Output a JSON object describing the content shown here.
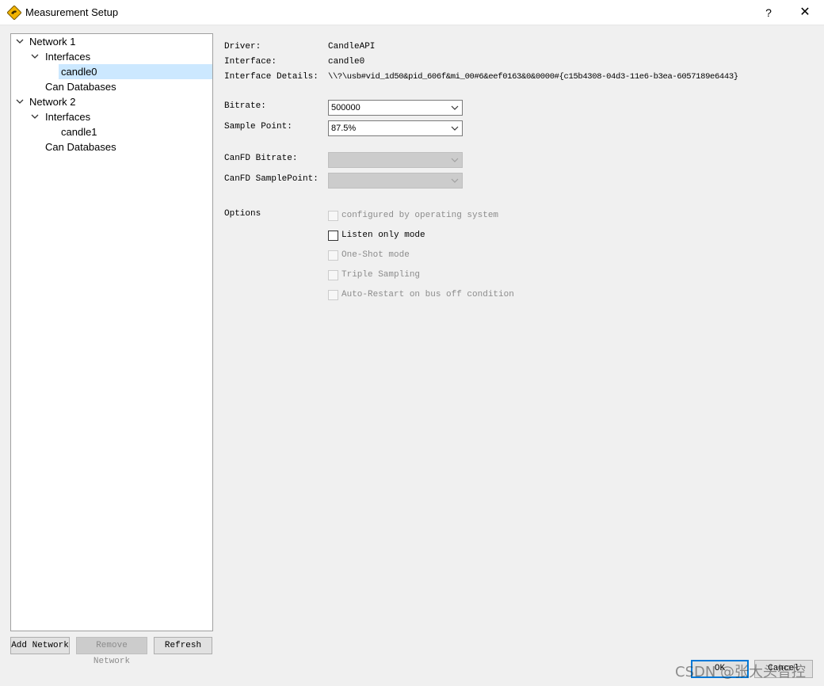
{
  "window": {
    "title": "Measurement Setup",
    "help": "?",
    "close": "✕"
  },
  "icons": {
    "app": "kangaroo-diamond-icon",
    "expanded": "chevron-down-icon",
    "dropdown": "chevron-down-icon",
    "close": "close-icon",
    "help": "help-icon"
  },
  "colors": {
    "selection": "#cce8ff",
    "default_button_border": "#0078d7",
    "app_icon": "#f2b400"
  },
  "tree": {
    "network1": "Network 1",
    "network1_interfaces": "Interfaces",
    "network1_interface0": "candle0",
    "network1_databases": "Can Databases",
    "network2": "Network 2",
    "network2_interfaces": "Interfaces",
    "network2_interface0": "candle1",
    "network2_databases": "Can Databases",
    "selected": "candle0"
  },
  "tree_buttons": {
    "add": "Add Network",
    "remove": "Remove Network",
    "refresh": "Refresh"
  },
  "details": {
    "driver_label": "Driver:",
    "driver_value": "CandleAPI",
    "interface_label": "Interface:",
    "interface_value": "candle0",
    "interface_details_label": "Interface Details:",
    "interface_details_value": "\\\\?\\usb#vid_1d50&pid_606f&mi_00#6&eef0163&0&0000#{c15b4308-04d3-11e6-b3ea-6057189e6443}"
  },
  "settings": {
    "bitrate_label": "Bitrate:",
    "bitrate_value": "500000",
    "sample_point_label": "Sample Point:",
    "sample_point_value": "87.5%",
    "canfd_bitrate_label": "CanFD Bitrate:",
    "canfd_bitrate_value": "",
    "canfd_samplepoint_label": "CanFD SamplePoint:",
    "canfd_samplepoint_value": ""
  },
  "options": {
    "label": "Options",
    "configured_by_os": "configured by operating system",
    "listen_only": "Listen only mode",
    "one_shot": "One-Shot mode",
    "triple_sampling": "Triple Sampling",
    "auto_restart": "Auto-Restart on bus off condition"
  },
  "dialog_buttons": {
    "ok": "OK",
    "cancel": "Cancel"
  },
  "watermark": "CSDN @张大头智控"
}
